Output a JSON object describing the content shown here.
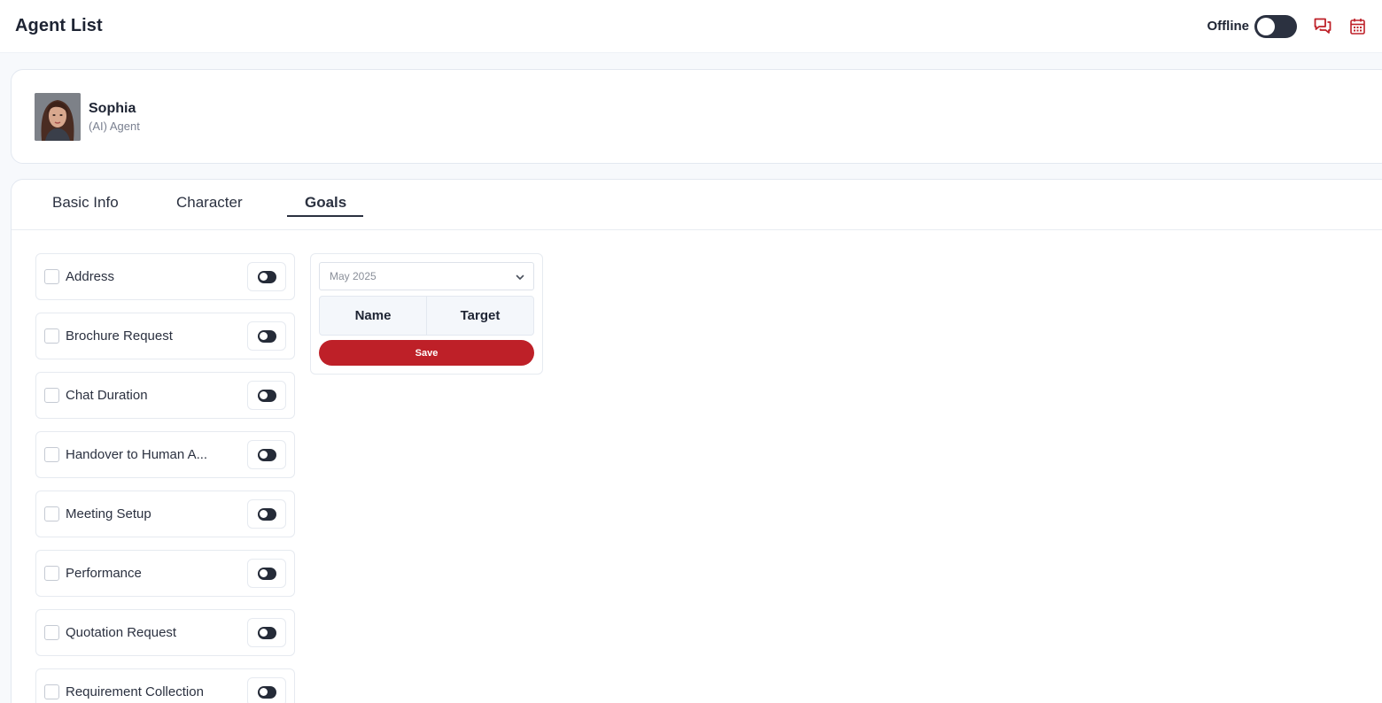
{
  "header": {
    "title": "Agent List",
    "status_label": "Offline",
    "status_on": false,
    "icons": [
      "chat-icon",
      "calendar-icon"
    ],
    "accent_color": "#be2028"
  },
  "profile": {
    "name": "Sophia",
    "role": "(AI) Agent"
  },
  "tabs": [
    {
      "label": "Basic Info",
      "active": false
    },
    {
      "label": "Character",
      "active": false
    },
    {
      "label": "Goals",
      "active": true
    }
  ],
  "goals": [
    {
      "label": "Address",
      "checked": false,
      "enabled": false
    },
    {
      "label": "Brochure Request",
      "checked": false,
      "enabled": false
    },
    {
      "label": "Chat Duration",
      "checked": false,
      "enabled": false
    },
    {
      "label": "Handover to Human A...",
      "checked": false,
      "enabled": false
    },
    {
      "label": "Meeting Setup",
      "checked": false,
      "enabled": false
    },
    {
      "label": "Performance",
      "checked": false,
      "enabled": false
    },
    {
      "label": "Quotation Request",
      "checked": false,
      "enabled": false
    },
    {
      "label": "Requirement Collection",
      "checked": false,
      "enabled": false
    }
  ],
  "targets": {
    "month": "May 2025",
    "columns": [
      "Name",
      "Target"
    ],
    "save_label": "Save"
  }
}
